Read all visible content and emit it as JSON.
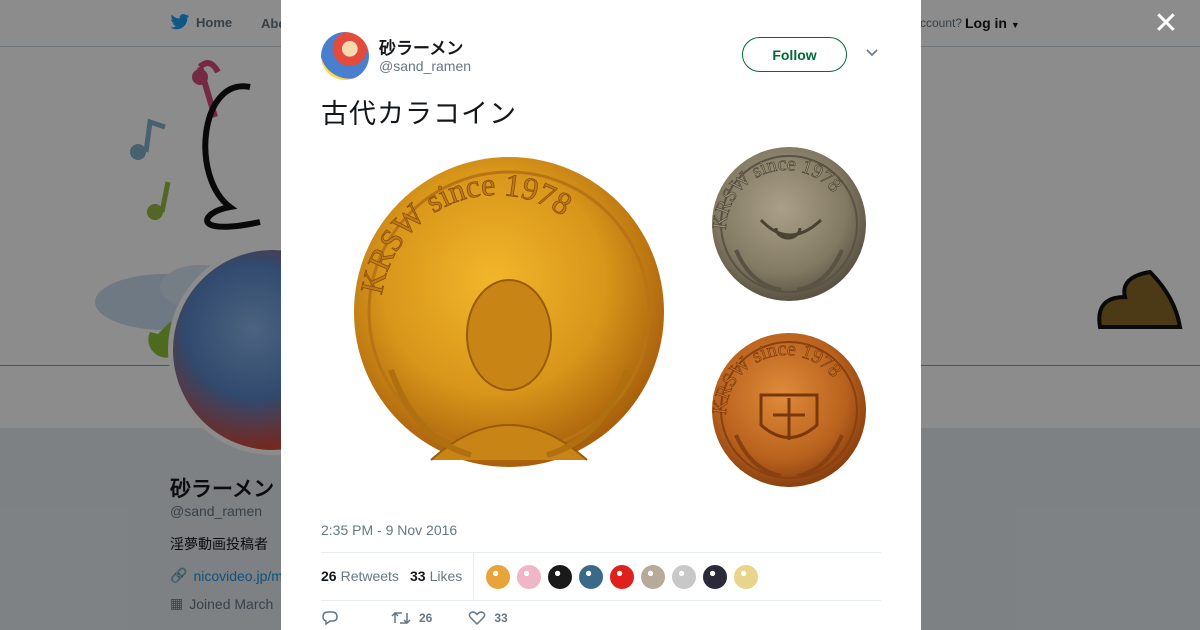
{
  "nav": {
    "home_label": "Home",
    "about_label": "Abo",
    "account_text": "ccount?",
    "login_label": "Log in"
  },
  "profile": {
    "name": "砂ラーメン",
    "handle": "@sand_ramen",
    "bio": "淫夢動画投稿者",
    "link": "nicovideo.jp/m",
    "joined": "Joined March"
  },
  "tweet": {
    "author_name": "砂ラーメン",
    "author_handle": "@sand_ramen",
    "follow_label": "Follow",
    "text": "古代カラコイン",
    "timestamp": "2:35 PM - 9 Nov 2016",
    "retweets_count": "26",
    "retweets_label": "Retweets",
    "likes_count": "33",
    "likes_label": "Likes",
    "reply_count": "",
    "action_retweets": "26",
    "action_likes": "33",
    "coin_inscription": "KRSW since 1978"
  },
  "likers": [
    "#e8a33a",
    "#f0b6c8",
    "#1a1a1a",
    "#3a6a8a",
    "#e0201a",
    "#b8aa98",
    "#c8c8c8",
    "#2a2a3a",
    "#e8d48a"
  ],
  "colors": {
    "follow": "#006a3a",
    "muted": "#657786",
    "link": "#1b95e0"
  }
}
